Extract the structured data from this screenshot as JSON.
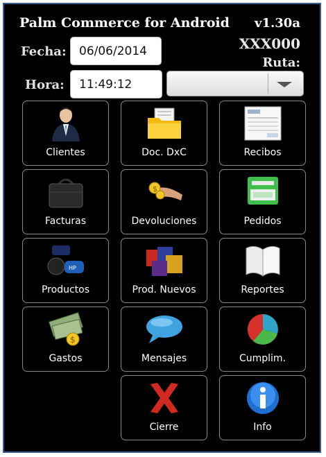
{
  "header": {
    "title": "Palm Commerce for Android",
    "version": "v1.30a",
    "code": "XXX000",
    "ruta_label": "Ruta:"
  },
  "form": {
    "fecha_label": "Fecha:",
    "fecha_value": "06/06/2014",
    "hora_label": "Hora:",
    "hora_value": "11:49:12",
    "ruta_value": ""
  },
  "menu": [
    {
      "label": "Clientes",
      "icon": "user-icon"
    },
    {
      "label": "Doc. DxC",
      "icon": "folder-icon"
    },
    {
      "label": "Recibos",
      "icon": "receipt-icon"
    },
    {
      "label": "Facturas",
      "icon": "briefcase-icon"
    },
    {
      "label": "Devoluciones",
      "icon": "hand-money-icon"
    },
    {
      "label": "Pedidos",
      "icon": "order-box-icon"
    },
    {
      "label": "Productos",
      "icon": "products-icon"
    },
    {
      "label": "Prod. Nuevos",
      "icon": "new-products-icon"
    },
    {
      "label": "Reportes",
      "icon": "book-icon"
    },
    {
      "label": "Gastos",
      "icon": "money-icon"
    },
    {
      "label": "Mensajes",
      "icon": "speech-bubble-icon"
    },
    {
      "label": "Cumplim.",
      "icon": "pie-chart-icon"
    },
    {
      "label": "Cierre",
      "icon": "close-x-icon"
    },
    {
      "label": "Info",
      "icon": "info-icon"
    }
  ]
}
